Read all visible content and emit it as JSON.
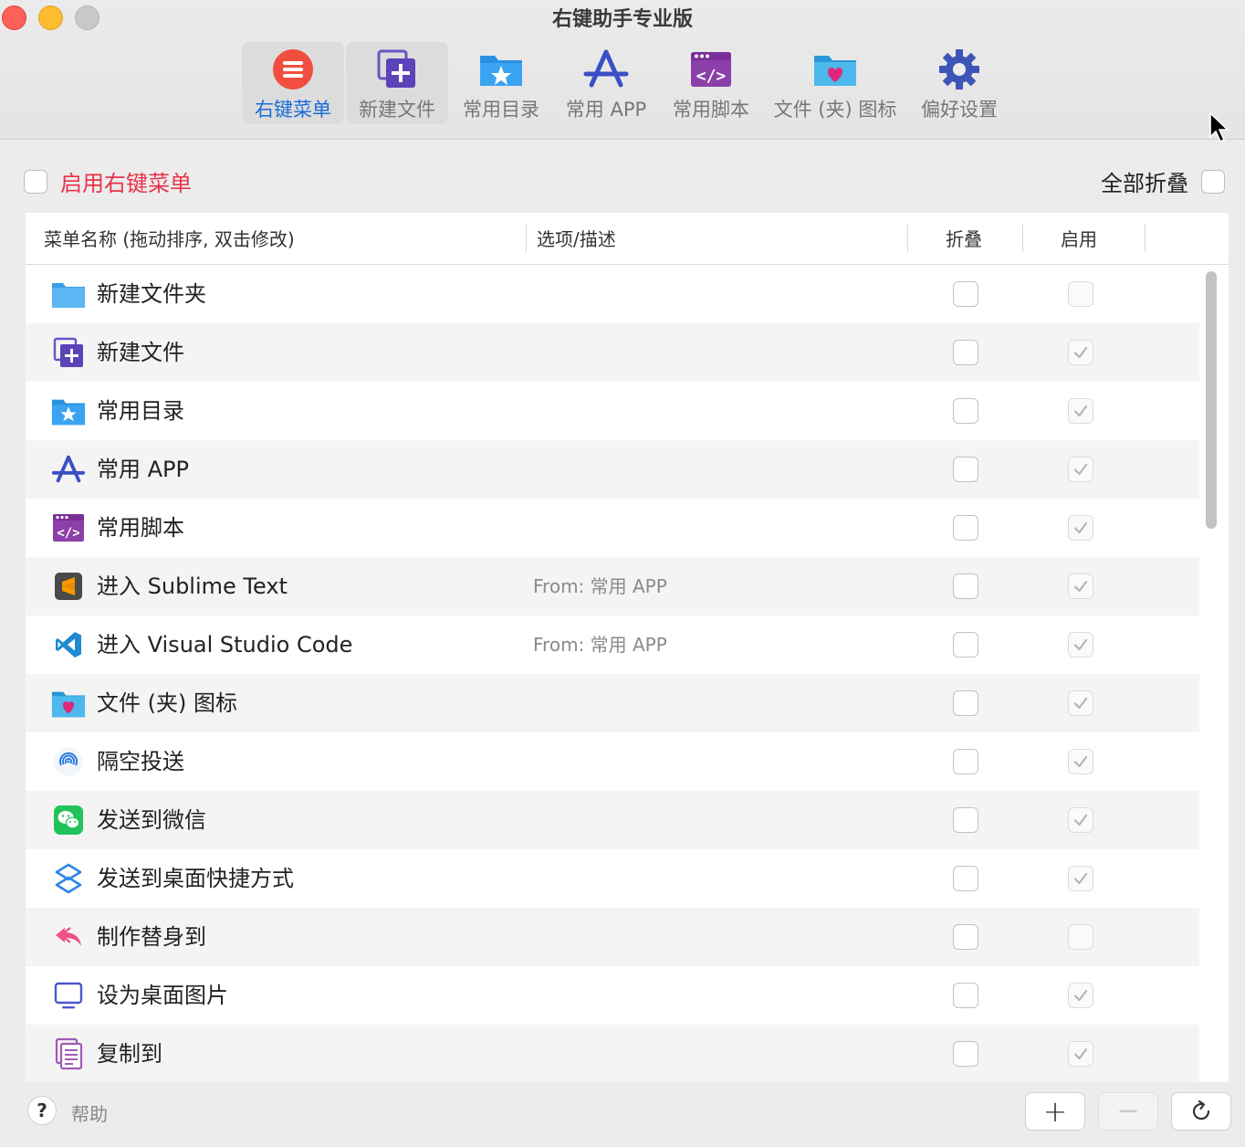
{
  "window": {
    "title": "右键助手专业版"
  },
  "toolbar": {
    "items": [
      {
        "label": "右键菜单",
        "icon": "context-menu-icon"
      },
      {
        "label": "新建文件",
        "icon": "new-file-icon"
      },
      {
        "label": "常用目录",
        "icon": "favorite-folder-icon"
      },
      {
        "label": "常用 APP",
        "icon": "app-store-icon"
      },
      {
        "label": "常用脚本",
        "icon": "script-icon"
      },
      {
        "label": "文件 (夹) 图标",
        "icon": "folder-heart-icon"
      },
      {
        "label": "偏好设置",
        "icon": "gear-icon"
      }
    ],
    "active_index": 0
  },
  "options": {
    "enable_label": "启用右键菜单",
    "enable_checked": false,
    "collapse_all_label": "全部折叠",
    "collapse_all_checked": false
  },
  "table": {
    "headers": {
      "name": "菜单名称 (拖动排序, 双击修改)",
      "desc": "选项/描述",
      "fold": "折叠",
      "enable": "启用"
    },
    "rows": [
      {
        "name": "新建文件夹",
        "desc": "",
        "fold": false,
        "enable": false,
        "icon": "folder-icon"
      },
      {
        "name": "新建文件",
        "desc": "",
        "fold": false,
        "enable": true,
        "icon": "new-file-icon"
      },
      {
        "name": "常用目录",
        "desc": "",
        "fold": false,
        "enable": true,
        "icon": "favorite-folder-icon"
      },
      {
        "name": "常用 APP",
        "desc": "",
        "fold": false,
        "enable": true,
        "icon": "app-store-icon"
      },
      {
        "name": "常用脚本",
        "desc": "",
        "fold": false,
        "enable": true,
        "icon": "script-icon"
      },
      {
        "name": "进入 Sublime Text",
        "desc": "From: 常用 APP",
        "fold": false,
        "enable": true,
        "icon": "sublime-text-icon"
      },
      {
        "name": "进入 Visual Studio Code",
        "desc": "From: 常用 APP",
        "fold": false,
        "enable": true,
        "icon": "vscode-icon"
      },
      {
        "name": "文件 (夹) 图标",
        "desc": "",
        "fold": false,
        "enable": true,
        "icon": "folder-heart-icon"
      },
      {
        "name": "隔空投送",
        "desc": "",
        "fold": false,
        "enable": true,
        "icon": "airdrop-icon"
      },
      {
        "name": "发送到微信",
        "desc": "",
        "fold": false,
        "enable": true,
        "icon": "wechat-icon"
      },
      {
        "name": "发送到桌面快捷方式",
        "desc": "",
        "fold": false,
        "enable": true,
        "icon": "shortcut-icon"
      },
      {
        "name": "制作替身到",
        "desc": "",
        "fold": false,
        "enable": false,
        "icon": "alias-icon"
      },
      {
        "name": "设为桌面图片",
        "desc": "",
        "fold": false,
        "enable": true,
        "icon": "desktop-picture-icon"
      },
      {
        "name": "复制到",
        "desc": "",
        "fold": false,
        "enable": true,
        "icon": "copy-to-icon"
      }
    ]
  },
  "footer": {
    "help_label": "帮助",
    "help_symbol": "?",
    "add_symbol": "+",
    "remove_symbol": "−"
  }
}
